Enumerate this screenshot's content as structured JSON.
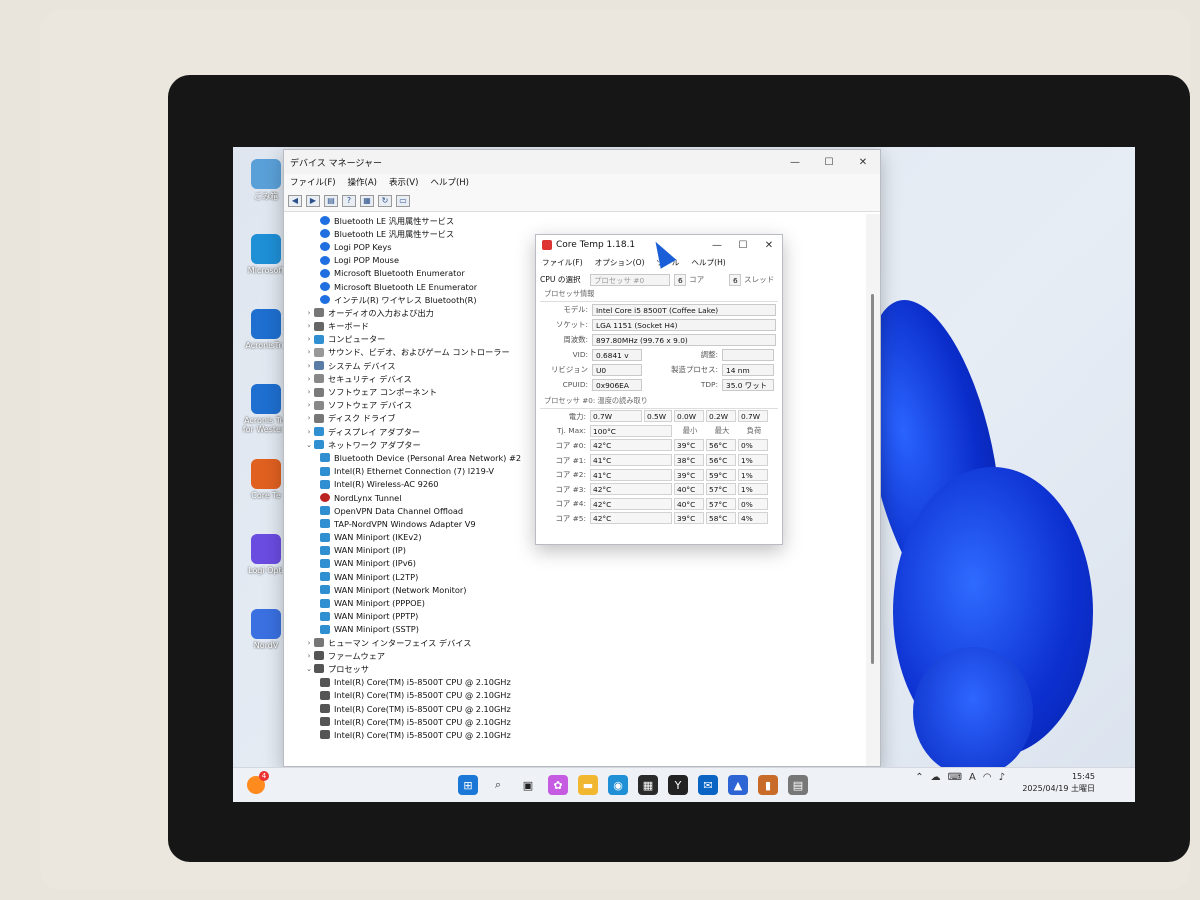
{
  "desktop_icons": [
    {
      "label": "ごみ箱",
      "icon": "recycle-bin-icon",
      "color": "#5aa0d8"
    },
    {
      "label": "Microsoft",
      "icon": "edge-icon",
      "color": "#1f8fd6"
    },
    {
      "label": "AcronisTru",
      "icon": "acronis-icon",
      "color": "#1e6fd0"
    },
    {
      "label": "Acronis Tru for Western",
      "icon": "acronis-icon",
      "color": "#1e6fd0"
    },
    {
      "label": "Core Te",
      "icon": "core-temp-icon",
      "color": "#e06020"
    },
    {
      "label": "Logi Opti",
      "icon": "logi-options-icon",
      "color": "#6a4ce0"
    },
    {
      "label": "NordV",
      "icon": "nordvpn-icon",
      "color": "#3a70e0"
    }
  ],
  "device_manager": {
    "title": "デバイス マネージャー",
    "menu": [
      "ファイル(F)",
      "操作(A)",
      "表示(V)",
      "ヘルプ(H)"
    ],
    "tree": [
      {
        "label": "Bluetooth LE 汎用属性サービス",
        "level": 2,
        "icon": "bluetooth-icon"
      },
      {
        "label": "Bluetooth LE 汎用属性サービス",
        "level": 2,
        "icon": "bluetooth-icon"
      },
      {
        "label": "Logi POP Keys",
        "level": 2,
        "icon": "bluetooth-icon"
      },
      {
        "label": "Logi POP Mouse",
        "level": 2,
        "icon": "bluetooth-icon"
      },
      {
        "label": "Microsoft Bluetooth Enumerator",
        "level": 2,
        "icon": "bluetooth-icon"
      },
      {
        "label": "Microsoft Bluetooth LE Enumerator",
        "level": 2,
        "icon": "bluetooth-icon"
      },
      {
        "label": "インテル(R) ワイヤレス Bluetooth(R)",
        "level": 2,
        "icon": "bluetooth-icon"
      },
      {
        "label": "オーディオの入力および出力",
        "level": 1,
        "icon": "audio-icon",
        "exp": "›"
      },
      {
        "label": "キーボード",
        "level": 1,
        "icon": "keyboard-icon",
        "exp": "›"
      },
      {
        "label": "コンピューター",
        "level": 1,
        "icon": "computer-icon",
        "exp": "›"
      },
      {
        "label": "サウンド、ビデオ、およびゲーム コントローラー",
        "level": 1,
        "icon": "sound-icon",
        "exp": "›"
      },
      {
        "label": "システム デバイス",
        "level": 1,
        "icon": "system-icon",
        "exp": "›"
      },
      {
        "label": "セキュリティ デバイス",
        "level": 1,
        "icon": "security-icon",
        "exp": "›"
      },
      {
        "label": "ソフトウェア コンポーネント",
        "level": 1,
        "icon": "component-icon",
        "exp": "›"
      },
      {
        "label": "ソフトウェア デバイス",
        "level": 1,
        "icon": "software-icon",
        "exp": "›"
      },
      {
        "label": "ディスク ドライブ",
        "level": 1,
        "icon": "disk-icon",
        "exp": "›"
      },
      {
        "label": "ディスプレイ アダプター",
        "level": 1,
        "icon": "display-icon",
        "exp": "›"
      },
      {
        "label": "ネットワーク アダプター",
        "level": 1,
        "icon": "network-icon",
        "exp": "⌄"
      },
      {
        "label": "Bluetooth Device (Personal Area Network) #2",
        "level": 2,
        "icon": "network-icon"
      },
      {
        "label": "Intel(R) Ethernet Connection (7) I219-V",
        "level": 2,
        "icon": "network-icon"
      },
      {
        "label": "Intel(R) Wireless-AC 9260",
        "level": 2,
        "icon": "network-icon"
      },
      {
        "label": "NordLynx Tunnel",
        "level": 2,
        "icon": "nordlynx-icon"
      },
      {
        "label": "OpenVPN Data Channel Offload",
        "level": 2,
        "icon": "network-icon"
      },
      {
        "label": "TAP-NordVPN Windows Adapter V9",
        "level": 2,
        "icon": "network-icon"
      },
      {
        "label": "WAN Miniport (IKEv2)",
        "level": 2,
        "icon": "network-icon"
      },
      {
        "label": "WAN Miniport (IP)",
        "level": 2,
        "icon": "network-icon"
      },
      {
        "label": "WAN Miniport (IPv6)",
        "level": 2,
        "icon": "network-icon"
      },
      {
        "label": "WAN Miniport (L2TP)",
        "level": 2,
        "icon": "network-icon"
      },
      {
        "label": "WAN Miniport (Network Monitor)",
        "level": 2,
        "icon": "network-icon"
      },
      {
        "label": "WAN Miniport (PPPOE)",
        "level": 2,
        "icon": "network-icon"
      },
      {
        "label": "WAN Miniport (PPTP)",
        "level": 2,
        "icon": "network-icon"
      },
      {
        "label": "WAN Miniport (SSTP)",
        "level": 2,
        "icon": "network-icon"
      },
      {
        "label": "ヒューマン インターフェイス デバイス",
        "level": 1,
        "icon": "hid-icon",
        "exp": "›"
      },
      {
        "label": "ファームウェア",
        "level": 1,
        "icon": "firmware-icon",
        "exp": "›"
      },
      {
        "label": "プロセッサ",
        "level": 1,
        "icon": "processor-icon",
        "exp": "⌄"
      },
      {
        "label": "Intel(R) Core(TM) i5-8500T CPU @ 2.10GHz",
        "level": 2,
        "icon": "processor-icon"
      },
      {
        "label": "Intel(R) Core(TM) i5-8500T CPU @ 2.10GHz",
        "level": 2,
        "icon": "processor-icon"
      },
      {
        "label": "Intel(R) Core(TM) i5-8500T CPU @ 2.10GHz",
        "level": 2,
        "icon": "processor-icon"
      },
      {
        "label": "Intel(R) Core(TM) i5-8500T CPU @ 2.10GHz",
        "level": 2,
        "icon": "processor-icon"
      },
      {
        "label": "Intel(R) Core(TM) i5-8500T CPU @ 2.10GHz",
        "level": 2,
        "icon": "processor-icon"
      }
    ]
  },
  "core_temp": {
    "title": "Core Temp 1.18.1",
    "menu": [
      "ファイル(F)",
      "オプション(O)",
      "ツール",
      "ヘルプ(H)"
    ],
    "cpu_select_label": "CPU の選択",
    "processor_select": "プロセッサ #0",
    "cores_value": "6",
    "cores_label": "コア",
    "threads_value": "6",
    "threads_label": "スレッド",
    "section_info": "プロセッサ情報",
    "model_label": "モデル:",
    "model": "Intel Core i5 8500T (Coffee Lake)",
    "socket_label": "ソケット:",
    "socket": "LGA 1151 (Socket H4)",
    "freq_label": "周波数:",
    "freq": "897.80MHz (99.76 x 9.0)",
    "vid_label": "VID:",
    "vid": "0.6841 v",
    "adjust_label": "調整:",
    "adjust": "",
    "revision_label": "リビジョン",
    "revision": "U0",
    "process_label": "製造プロセス:",
    "process": "14 nm",
    "cpuid_label": "CPUID:",
    "cpuid": "0x906EA",
    "tdp_label": "TDP:",
    "tdp": "35.0 ワット",
    "section_temp": "プロセッサ #0: 温度の読み取り",
    "power_label": "電力:",
    "power": [
      "0.7W",
      "0.5W",
      "0.0W",
      "0.2W",
      "0.7W"
    ],
    "tjmax_label": "Tj. Max:",
    "tjmax": "100°C",
    "col_min": "最小",
    "col_max": "最大",
    "col_load": "負荷",
    "cores": [
      {
        "label": "コア #0:",
        "temp": "42°C",
        "min": "39°C",
        "max": "56°C",
        "load": "0%"
      },
      {
        "label": "コア #1:",
        "temp": "41°C",
        "min": "38°C",
        "max": "56°C",
        "load": "1%"
      },
      {
        "label": "コア #2:",
        "temp": "41°C",
        "min": "39°C",
        "max": "59°C",
        "load": "1%"
      },
      {
        "label": "コア #3:",
        "temp": "42°C",
        "min": "40°C",
        "max": "57°C",
        "load": "1%"
      },
      {
        "label": "コア #4:",
        "temp": "42°C",
        "min": "40°C",
        "max": "57°C",
        "load": "0%"
      },
      {
        "label": "コア #5:",
        "temp": "42°C",
        "min": "39°C",
        "max": "58°C",
        "load": "4%"
      }
    ]
  },
  "taskbar": {
    "badge": "4",
    "apps": [
      {
        "name": "start-icon",
        "color": "#1b78d6",
        "glyph": "⊞"
      },
      {
        "name": "search-icon",
        "color": "#333333",
        "glyph": "⌕"
      },
      {
        "name": "task-view-icon",
        "color": "#222222",
        "glyph": "▣"
      },
      {
        "name": "copilot-icon",
        "color": "#c45be0",
        "glyph": "✿"
      },
      {
        "name": "explorer-icon",
        "color": "#f2b731",
        "glyph": "▬"
      },
      {
        "name": "edge-icon",
        "color": "#1f8fd6",
        "glyph": "◉"
      },
      {
        "name": "store-icon",
        "color": "#2a2a2a",
        "glyph": "▦"
      },
      {
        "name": "yahoo-icon",
        "color": "#222222",
        "glyph": "Y"
      },
      {
        "name": "outlook-icon",
        "color": "#0a64c4",
        "glyph": "✉"
      },
      {
        "name": "nordvpn-icon",
        "color": "#2d66d4",
        "glyph": "▲"
      },
      {
        "name": "core-temp-taskbar-icon",
        "color": "#c86a28",
        "glyph": "▮"
      },
      {
        "name": "device-manager-taskbar-icon",
        "color": "#777777",
        "glyph": "▤"
      }
    ],
    "time": "15:45",
    "date": "2025/04/19 土曜日"
  }
}
